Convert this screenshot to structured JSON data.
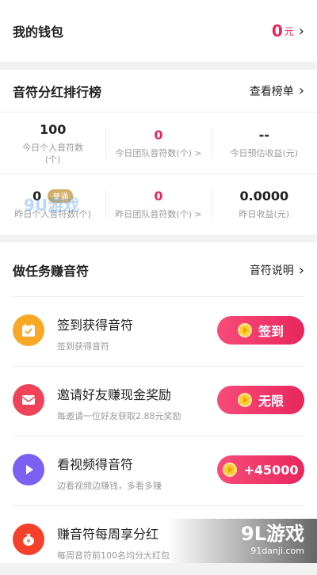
{
  "wallet": {
    "title": "我的钱包",
    "amount": "0",
    "unit": "元"
  },
  "ranking": {
    "title": "音符分红排行榜",
    "link": "查看榜单",
    "today": [
      {
        "value": "100",
        "label": "今日个人音符数(个)"
      },
      {
        "value": "0",
        "label": "今日团队音符数(个) >"
      },
      {
        "value": "--",
        "label": "今日预估收益(元)"
      }
    ],
    "yesterday": [
      {
        "value": "0",
        "badge": "普通",
        "label": "昨日个人音符数(个)"
      },
      {
        "value": "0",
        "label": "昨日团队音符数(个) >"
      },
      {
        "value": "0.0000",
        "label": "昨日收益(元)"
      }
    ]
  },
  "tasks": {
    "title": "做任务赚音符",
    "link": "音符说明",
    "items": [
      {
        "title": "签到获得音符",
        "subtitle": "签到获得音符",
        "button": "签到",
        "color": "#f9a825"
      },
      {
        "title": "邀请好友赚现金奖励",
        "subtitle": "每邀请一位好友获取2.88元奖励",
        "button": "无限",
        "color": "#f0435a"
      },
      {
        "title": "看视频得音符",
        "subtitle": "边看视频边赚钱，多看多赚",
        "button": "+45000",
        "color": "#7b61f2"
      },
      {
        "title": "赚音符每周享分红",
        "subtitle": "每周音符前100名均分大红包",
        "button": "",
        "color": "#f5402c"
      }
    ]
  },
  "watermark": {
    "left": "9U游戏",
    "brand": "9L游戏",
    "site": "91danji.com"
  },
  "colors": {
    "accent": "#e8265d",
    "badge": "#d2b06b"
  }
}
